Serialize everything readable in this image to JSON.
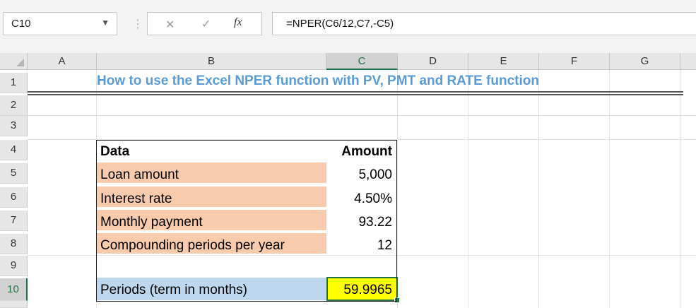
{
  "formula_bar": {
    "name_box": "C10",
    "formula": "=NPER(C6/12,C7,-C5)",
    "fx_label": "fx"
  },
  "columns": [
    "A",
    "B",
    "C",
    "D",
    "E",
    "F",
    "G"
  ],
  "rows": [
    "1",
    "2",
    "3",
    "4",
    "5",
    "6",
    "7",
    "8",
    "9",
    "10"
  ],
  "title": "How to use the Excel NPER function with PV, PMT and RATE function",
  "table": {
    "header_label": "Data",
    "header_value": "Amount",
    "items": [
      {
        "label": "Loan amount",
        "value": "5,000"
      },
      {
        "label": "Interest rate",
        "value": "4.50%"
      },
      {
        "label": "Monthly payment",
        "value": "93.22"
      },
      {
        "label": "Compounding periods per year",
        "value": "12"
      }
    ],
    "result_label": "Periods (term in months)",
    "result_value": "59.9965"
  },
  "colors": {
    "title": "#5b9bd5",
    "label_fill": "#f8cbad",
    "result_label_fill": "#bdd7ee",
    "result_value_fill": "#ffff00",
    "selection": "#217346"
  }
}
